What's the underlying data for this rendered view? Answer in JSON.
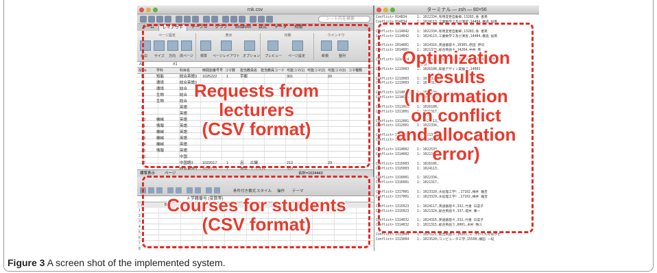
{
  "excel": {
    "window_title": "rnk.csv",
    "search_placeholder": "シート内を検索",
    "tabs": [
      "ホーム",
      "レイアウト",
      "テーブル",
      "グラフ",
      "SmartArt",
      "数式",
      "データ",
      "校閲"
    ],
    "ribbon_groups": [
      {
        "label": "ページ設定",
        "captions": [
          "余白",
          "サイズ",
          "方向",
          "改ページ"
        ]
      },
      {
        "label": "表示",
        "captions": [
          "標準",
          "ページレイアウト",
          "オプション"
        ]
      },
      {
        "label": "印刷",
        "captions": [
          "プレビュー",
          "ページ設定"
        ]
      },
      {
        "label": "ウインドウ",
        "captions": [
          "新規",
          "整列"
        ]
      }
    ],
    "cell_ref": "A2",
    "formula_value": "#1",
    "columns": [
      "授No.",
      "学科",
      "科目名",
      "時間割番号号",
      "コマ数",
      "担当教員名",
      "担当教員コード",
      "可能コマ(1)",
      "可能コマ(2)",
      "可能コマ(3)",
      "コマ種類"
    ],
    "rows": [
      [
        "5",
        "知能",
        "総合英語3",
        "1025222",
        "1",
        "宇都",
        "",
        "301",
        "",
        "20"
      ],
      [
        "6",
        "環境",
        "総合英語3",
        "",
        "",
        "",
        "",
        "",
        "",
        ""
      ],
      [
        "6",
        "環境",
        "総合",
        "",
        "",
        "",
        "",
        "",
        "",
        ""
      ],
      [
        "7",
        "生物",
        "総合",
        "",
        "",
        "",
        "",
        "",
        "",
        ""
      ],
      [
        "7",
        "生物",
        "総合",
        "",
        "",
        "",
        "",
        "",
        "",
        ""
      ],
      [
        "8",
        "",
        "英語",
        "",
        "",
        "",
        "",
        "",
        "",
        ""
      ],
      [
        "9",
        "",
        "英語",
        "",
        "",
        "",
        "",
        "",
        "",
        ""
      ],
      [
        "10",
        "機械",
        "英語",
        "",
        "",
        "",
        "",
        "",
        "",
        ""
      ],
      [
        "11",
        "情報",
        "英語",
        "",
        "",
        "",
        "",
        "",
        "",
        ""
      ],
      [
        "12",
        "機械",
        "英語",
        "",
        "",
        "",
        "",
        "",
        "",
        ""
      ],
      [
        "13",
        "機械",
        "英語",
        "",
        "",
        "",
        "",
        "",
        "",
        ""
      ],
      [
        "14",
        "機械",
        "英語",
        "",
        "",
        "",
        "",
        "",
        "",
        ""
      ],
      [
        "15",
        "情報",
        "英語",
        "",
        "",
        "",
        "",
        "",
        "",
        ""
      ],
      [
        "16",
        "",
        "中国",
        "",
        "",
        "",
        "",
        "",
        "",
        ""
      ],
      [
        "17",
        "",
        "中国語3",
        "1022017",
        "1",
        "呂",
        "広鍵",
        "212",
        "",
        "29"
      ],
      [
        "",
        "",
        "総合英語3",
        "1025122",
        "1",
        "堤井",
        "エリザベ",
        "322",
        "",
        ""
      ],
      [
        "",
        "",
        "総合英語3",
        "1025323",
        "1",
        "堤井",
        "エリザベ",
        "322",
        "",
        ""
      ],
      [
        "20",
        "",
        "英語特別演習",
        "1022131",
        "1",
        "堤井",
        "エリザベ",
        "322",
        "",
        ""
      ]
    ],
    "sheet_tabs": [
      "標準表示",
      "ページ"
    ],
    "sum_label": "合計=1024443"
  },
  "excel2": {
    "toolbar_labels": [
      "条件付き書式",
      "スタイル",
      "操作",
      "テーマ"
    ],
    "cell_value": "# 学籍番号 (変数等)",
    "columns": [
      "A",
      "B",
      "C",
      "D",
      "E",
      "F",
      "G",
      "H",
      "I"
    ],
    "rows": [
      [
        "1",
        "",
        "",
        "",
        "",
        "",
        "",
        "",
        ""
      ],
      [
        "2",
        "",
        "",
        "",
        "",
        "",
        "",
        "",
        ""
      ],
      [
        "3",
        "",
        "",
        "",
        "",
        "",
        "",
        "",
        ""
      ],
      [
        "4",
        "",
        "",
        "",
        "",
        "",
        "",
        "",
        ""
      ],
      [
        "5",
        "",
        "",
        "",
        "",
        "",
        "",
        "",
        ""
      ],
      [
        "6",
        "",
        "",
        "",
        "",
        "",
        "",
        "",
        ""
      ],
      [
        "7",
        "",
        "",
        "",
        "",
        "",
        "",
        "",
        ""
      ],
      [
        "8",
        "",
        "",
        "",
        "",
        "",
        "",
        "",
        ""
      ]
    ]
  },
  "terminal": {
    "title": "ターミナル — zsh — 80×56",
    "lines": [
      {
        "tag": "Conflict>",
        "id": "014834",
        "rest": "1: 1022334,有用変更自動車,13283,身 者英"
      },
      {
        "tag": "Conflict>",
        "id": "014834",
        "rest": "1: 1024113,工業数学２及び演習,14484,横追 加英"
      },
      {
        "tag": "",
        "id": "",
        "rest": ""
      },
      {
        "tag": "Conflict>",
        "id": "1114042",
        "rest": "1: 1022334,有用変更自動車,13283,身 者英"
      },
      {
        "tag": "Conflict>",
        "id": "1114042",
        "rest": "1: 1024113,工業数学２及び演習,14484,横追 加英"
      },
      {
        "tag": "",
        "id": "",
        "rest": ""
      },
      {
        "tag": "Conflict>",
        "id": "1014001",
        "rest": "1: 1024316,英語基礎４,10305,原田 伊司"
      },
      {
        "tag": "Conflict>",
        "id": "1014001",
        "rest": "1: 1021323,総合英語４,14204,中井 英"
      },
      {
        "tag": "",
        "id": "",
        "rest": ""
      },
      {
        "tag": "Conflict>",
        "id": "1214004",
        "rest": "1: 1022533,知能デザイン実験２,14003,知能デザイン"
      },
      {
        "tag": "",
        "id": "",
        "rest": "ン演習"
      },
      {
        "tag": "Conflict>",
        "id": "1213003",
        "rest": "1: 1026106,知能デザイン実験２,14003"
      },
      {
        "tag": "",
        "id": "",
        "rest": ""
      },
      {
        "tag": "Conflict>",
        "id": "1213003",
        "rest": "1: 1021325,"
      },
      {
        "tag": "Conflict>",
        "id": "1213003",
        "rest": "1: 1024316,"
      },
      {
        "tag": "",
        "id": "",
        "rest": ""
      },
      {
        "tag": "Conflict>",
        "id": "1214001",
        "rest": "1: 1022334,"
      },
      {
        "tag": "Conflict>",
        "id": "1214001",
        "rest": "1: 1024113,"
      },
      {
        "tag": "",
        "id": "",
        "rest": ""
      },
      {
        "tag": "Conflict>",
        "id": "1311001",
        "rest": "1: 1026108,"
      },
      {
        "tag": "Conflict>",
        "id": "1311001",
        "rest": "1: 1021317,"
      },
      {
        "tag": "",
        "id": "",
        "rest": ""
      },
      {
        "tag": "Conflict>",
        "id": "1312001",
        "rest": "1: 1024113,"
      },
      {
        "tag": "Conflict>",
        "id": "1312001",
        "rest": "1: 1022334,"
      },
      {
        "tag": "",
        "id": "",
        "rest": ""
      },
      {
        "tag": "Conflict>",
        "id": "1313001",
        "rest": "1: 1021323,"
      },
      {
        "tag": "Conflict>",
        "id": "1313001",
        "rest": "1: 1024316,"
      },
      {
        "tag": "",
        "id": "",
        "rest": ""
      },
      {
        "tag": "Conflict>",
        "id": "1314002",
        "rest": "1: 1022533,"
      },
      {
        "tag": "Conflict>",
        "id": "1314002",
        "rest": "1: 1021325,"
      },
      {
        "tag": "",
        "id": "",
        "rest": ""
      },
      {
        "tag": "Conflict>",
        "id": "1315003",
        "rest": "1: 1026106,"
      },
      {
        "tag": "Conflict>",
        "id": "1315003",
        "rest": "1: 1024113,"
      },
      {
        "tag": "",
        "id": "",
        "rest": ""
      },
      {
        "tag": "Conflict>",
        "id": "1316001",
        "rest": "1: 1022334,"
      },
      {
        "tag": "Conflict>",
        "id": "1316001",
        "rest": "1: 1021317,"
      },
      {
        "tag": "",
        "id": "",
        "rest": ""
      },
      {
        "tag": "Conflict>",
        "id": "1317001",
        "rest": "1: 1023329,水処理工学！,17102,梅井 雅吉"
      },
      {
        "tag": "Conflict>",
        "id": "1317001",
        "rest": "1: 1023329,水処理工学！,17102,梅井 雅吉"
      },
      {
        "tag": "",
        "id": "",
        "rest": ""
      },
      {
        "tag": "Conflict>",
        "id": "1315023",
        "rest": "1: 1024117,英語基礎４,332,竹重 日菜子"
      },
      {
        "tag": "Conflict>",
        "id": "1315023",
        "rest": "1: 1021324,総合英語４,337,堤井 練一"
      },
      {
        "tag": "",
        "id": "",
        "rest": ""
      },
      {
        "tag": "Conflict>",
        "id": "1314032",
        "rest": "1: 1024316,英語基礎４,332,竹重 日菜子"
      },
      {
        "tag": "Conflict>",
        "id": "1314032",
        "rest": "1: 1021315,総合英語３,6001,木村 晴三"
      },
      {
        "tag": "",
        "id": "",
        "rest": ""
      },
      {
        "tag": "Conflict>",
        "id": "1313004",
        "rest": "1: 1025121,総合英語３,10201,三 かわくだのおかた"
      },
      {
        "tag": "Conflict>",
        "id": "1313004",
        "rest": "1: 1023520,コンピュータ工学,15509,横田 一紀"
      }
    ]
  },
  "callouts": {
    "requests": "Requests from lecturers (CSV format)",
    "requests_lines": [
      "Requests from",
      "lecturers",
      "(CSV format)"
    ],
    "courses_lines": [
      "Courses for students",
      "(CSV format)"
    ],
    "optimization_lines": [
      "Optimization",
      "results",
      "(Information",
      "on conflict",
      "and allocation",
      "error)"
    ],
    "color": "#e02b2b"
  },
  "caption": {
    "label": "Figure 3",
    "text": "A screen shot of the implemented system."
  }
}
